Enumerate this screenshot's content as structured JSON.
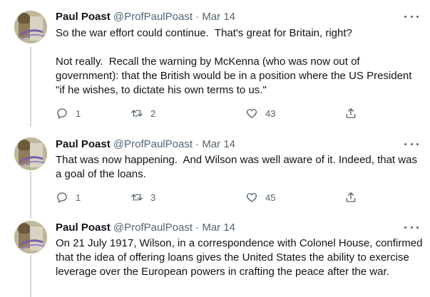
{
  "tweets": [
    {
      "name": "Paul Poast",
      "handle": "@ProfPaulPoast",
      "separator": "·",
      "date": "Mar 14",
      "text": "So the war effort could continue.  That's great for Britain, right?\n\nNot really.  Recall the warning by McKenna (who was now out of government): that the British would be in a position where the US President \"if he wishes, to dictate his own terms to us.\"",
      "replies": "1",
      "retweets": "2",
      "likes": "43"
    },
    {
      "name": "Paul Poast",
      "handle": "@ProfPaulPoast",
      "separator": "·",
      "date": "Mar 14",
      "text": "That was now happening.  And Wilson was well aware of it. Indeed, that was a goal of the loans.",
      "replies": "1",
      "retweets": "3",
      "likes": "45"
    },
    {
      "name": "Paul Poast",
      "handle": "@ProfPaulPoast",
      "separator": "·",
      "date": "Mar 14",
      "text": "On 21 July 1917, Wilson, in a correspondence with Colonel House, confirmed that the idea of offering loans gives the United States the ability to exercise leverage over the European powers in crafting the peace after the war."
    }
  ],
  "icons": {
    "reply": "reply-icon",
    "retweet": "retweet-icon",
    "like": "heart-icon",
    "share": "share-icon",
    "more": "more-icon"
  },
  "colors": {
    "secondary_text": "#536471",
    "primary_text": "#0f1419",
    "thread_line": "#cfd9de"
  }
}
